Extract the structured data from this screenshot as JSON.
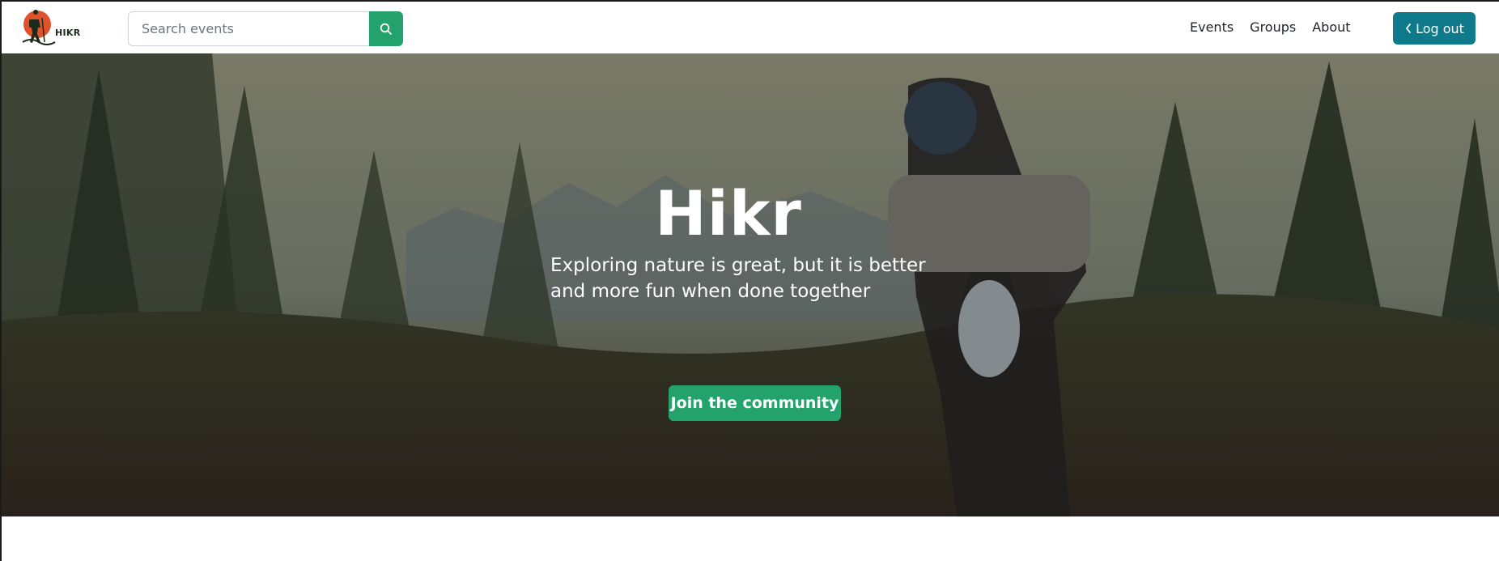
{
  "brand": {
    "name": "HIKR",
    "logo_icon": "hiker-logo-icon"
  },
  "search": {
    "placeholder": "Search events",
    "value": "",
    "icon": "search-icon"
  },
  "nav": {
    "items": [
      "Events",
      "Groups",
      "About"
    ]
  },
  "auth": {
    "logout_label": "Log out",
    "icon": "chevron-left-icon"
  },
  "hero": {
    "title": "Hikr",
    "subtitle": "Exploring nature is great, but it is better and more fun when done together",
    "cta_label": "Join the community"
  },
  "colors": {
    "primary_green": "#23a36b",
    "teal": "#0e7a8c",
    "logo_orange": "#e0522b"
  }
}
